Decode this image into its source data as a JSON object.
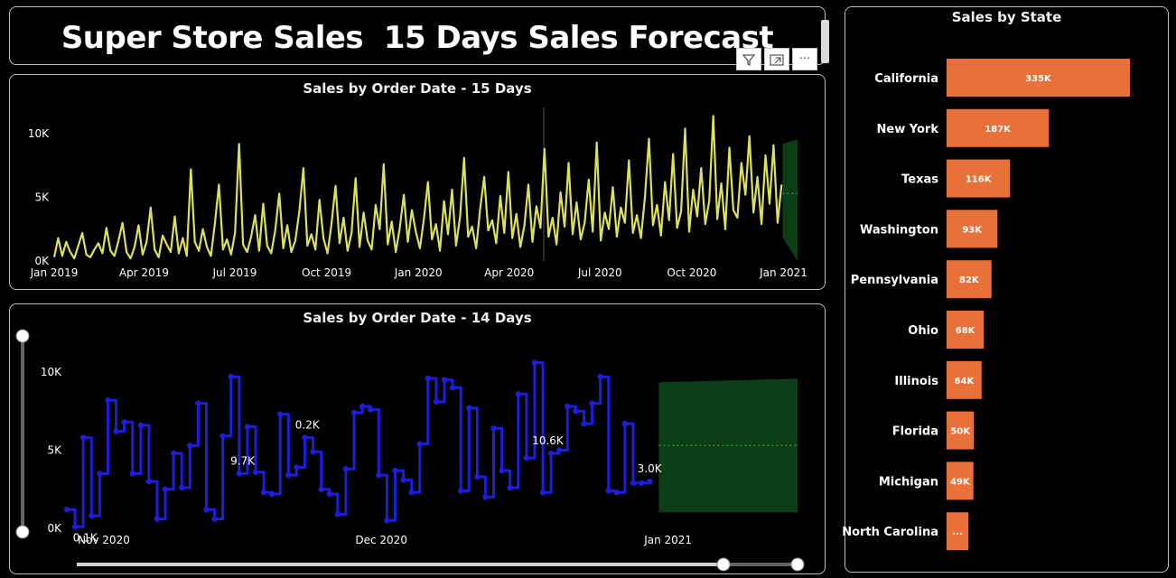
{
  "title": "Super Store Sales  15 Days Sales Forecast",
  "toolbar": {
    "filter_icon": "filter-icon",
    "focus_icon": "focus-mode-icon",
    "more_label": "···"
  },
  "colors": {
    "line1": "#dde05a",
    "line2": "#1d1ddb",
    "forecast": "#0b3d16",
    "bar": "#e8713a"
  },
  "chart_data": [
    {
      "type": "line",
      "title": "Sales by Order Date - 15 Days",
      "x_start": "2019-01-01",
      "x_end": "2020-12-30",
      "x_ticks": [
        "Jan 2019",
        "Apr 2019",
        "Jul 2019",
        "Oct 2019",
        "Jan 2020",
        "Apr 2020",
        "Jul 2020",
        "Oct 2020",
        "Jan 2021"
      ],
      "y_ticks": [
        "0K",
        "5K",
        "10K"
      ],
      "ylim": [
        0,
        10000
      ],
      "series": [
        {
          "values": [
            300,
            1800,
            400,
            1500,
            700,
            200,
            1200,
            2200,
            500,
            300,
            900,
            1400,
            600,
            2600,
            800,
            400,
            1600,
            3000,
            700,
            200,
            1100,
            2800,
            500,
            1500,
            4200,
            900,
            300,
            2000,
            1300,
            700,
            3500,
            600,
            1800,
            400,
            7200,
            1500,
            800,
            2500,
            1100,
            400,
            3000,
            6000,
            900,
            1700,
            500,
            2200,
            9200,
            1300,
            700,
            1900,
            3600,
            800,
            4500,
            1200,
            600,
            2400,
            5300,
            1000,
            2800,
            700,
            1600,
            3900,
            7300,
            1200,
            2100,
            900,
            4800,
            1800,
            600,
            2900,
            5900,
            1400,
            3400,
            800,
            2200,
            6500,
            1100,
            3800,
            1600,
            900,
            4400,
            2500,
            7600,
            1300,
            3100,
            700,
            2600,
            5200,
            1500,
            4000,
            2300,
            1000,
            3300,
            6200,
            1700,
            2900,
            800,
            4700,
            2100,
            5600,
            1200,
            3500,
            8100,
            1900,
            2700,
            1000,
            4100,
            6600,
            2400,
            3200,
            1400,
            5100,
            2200,
            7000,
            1800,
            3700,
            1100,
            2800,
            6000,
            1500,
            4300,
            2600,
            8800,
            1900,
            3400,
            1300,
            5400,
            2700,
            7700,
            2100,
            4600,
            1700,
            3000,
            6400,
            2300,
            9300,
            1600,
            3800,
            2500,
            5800,
            1900,
            4200,
            3000,
            7900,
            2200,
            3600,
            1800,
            5000,
            9600,
            2800,
            4400,
            2000,
            6200,
            3200,
            8400,
            2600,
            3900,
            10400,
            2300,
            5600,
            3500,
            7300,
            2900,
            4700,
            11400,
            3300,
            6100,
            2500,
            8900,
            4000,
            3400,
            7700,
            5200,
            9800,
            3800,
            6600,
            2900,
            8300,
            4500,
            9100,
            3000,
            6000
          ],
          "color": "#dde05a"
        }
      ],
      "forecast": {
        "start": "2020-12-31",
        "days": 15,
        "value": 5300
      }
    },
    {
      "type": "line",
      "title": "Sales by Order Date - 14 Days",
      "x_start": "2020-10-28",
      "x_end": "2020-12-30",
      "x_ticks": [
        "Nov 2020",
        "Dec 2020",
        "Jan 2021"
      ],
      "y_ticks": [
        "0K",
        "5K",
        "10K"
      ],
      "ylim": [
        0,
        10000
      ],
      "series": [
        {
          "values": [
            1200,
            100,
            5800,
            800,
            3500,
            8200,
            6200,
            6800,
            3500,
            6600,
            3000,
            600,
            2500,
            4800,
            2600,
            5300,
            8000,
            1200,
            600,
            5900,
            9700,
            3500,
            6500,
            3600,
            2300,
            2200,
            7300,
            3400,
            3900,
            5800,
            4900,
            2500,
            2200,
            900,
            3800,
            7400,
            7800,
            7600,
            3400,
            500,
            3700,
            3100,
            2300,
            5400,
            9600,
            8100,
            9500,
            9000,
            2400,
            7700,
            3300,
            2000,
            6400,
            3700,
            2600,
            8600,
            4500,
            10600,
            2300,
            4800,
            5000,
            7800,
            7500,
            6700,
            8000,
            9700,
            2400,
            2300,
            6700,
            2900,
            2900,
            3000
          ],
          "color": "#1d1ddb"
        }
      ],
      "data_labels": [
        {
          "x": "2020-10-29",
          "text": "0.1K"
        },
        {
          "x": "2020-11-16",
          "text": "9.7K"
        },
        {
          "x": "2020-11-23",
          "text": "0.2K"
        },
        {
          "x": "2020-12-19",
          "text": "10.6K"
        },
        {
          "x": "2020-12-30",
          "text": "3.0K"
        }
      ],
      "forecast": {
        "start": "2020-12-31",
        "days": 15,
        "value": 5300
      }
    },
    {
      "type": "bar",
      "orientation": "horizontal",
      "title": "Sales by State",
      "categories": [
        "California",
        "New York",
        "Texas",
        "Washington",
        "Pennsylvania",
        "Ohio",
        "Illinois",
        "Florida",
        "Michigan",
        "North Carolina"
      ],
      "values": [
        335,
        187,
        116,
        93,
        82,
        68,
        64,
        50,
        49,
        40
      ],
      "labels": [
        "335K",
        "187K",
        "116K",
        "93K",
        "82K",
        "68K",
        "64K",
        "50K",
        "49K",
        "..."
      ],
      "color": "#e8713a"
    }
  ]
}
